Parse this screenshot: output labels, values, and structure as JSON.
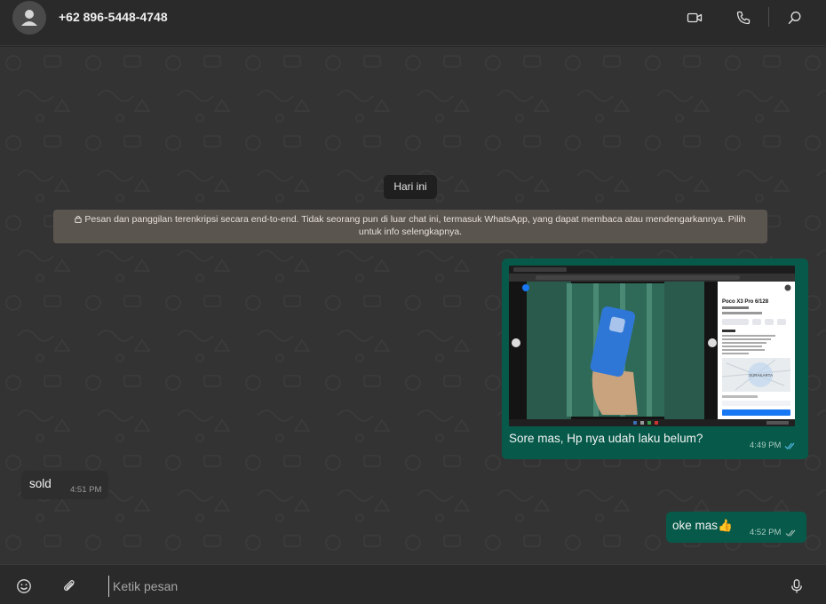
{
  "header": {
    "contact_name": "+62 896-5448-4748",
    "icons": [
      "avatar-placeholder-icon",
      "video-call-icon",
      "voice-call-icon",
      "search-icon"
    ]
  },
  "chat": {
    "date_label": "Hari ini",
    "encryption_notice": "Pesan dan panggilan terenkripsi secara end-to-end. Tidak seorang pun di luar chat ini, termasuk WhatsApp, yang dapat membaca atau mendengarkannya. Pilih untuk info selengkapnya.",
    "messages": [
      {
        "direction": "outgoing",
        "type": "image",
        "image_product_title": "Poco X3 Pro 6/128",
        "image_location_label": "SURAKARTA",
        "text": "Sore mas, Hp nya udah laku belum?",
        "time": "4:49 PM",
        "status": "read"
      },
      {
        "direction": "incoming",
        "type": "text",
        "text": "sold",
        "time": "4:51 PM"
      },
      {
        "direction": "outgoing",
        "type": "text",
        "text": "oke mas👍",
        "time": "4:52 PM",
        "status": "delivered"
      }
    ]
  },
  "composer": {
    "placeholder": "Ketik pesan",
    "icons": [
      "emoji-icon",
      "attach-icon",
      "microphone-icon"
    ]
  },
  "colors": {
    "outgoing_bubble": "#075a4a",
    "incoming_bubble": "#2e2e2e",
    "header_bg": "#2a2a2a",
    "chat_bg": "#333333",
    "read_tick": "#53bdeb"
  }
}
